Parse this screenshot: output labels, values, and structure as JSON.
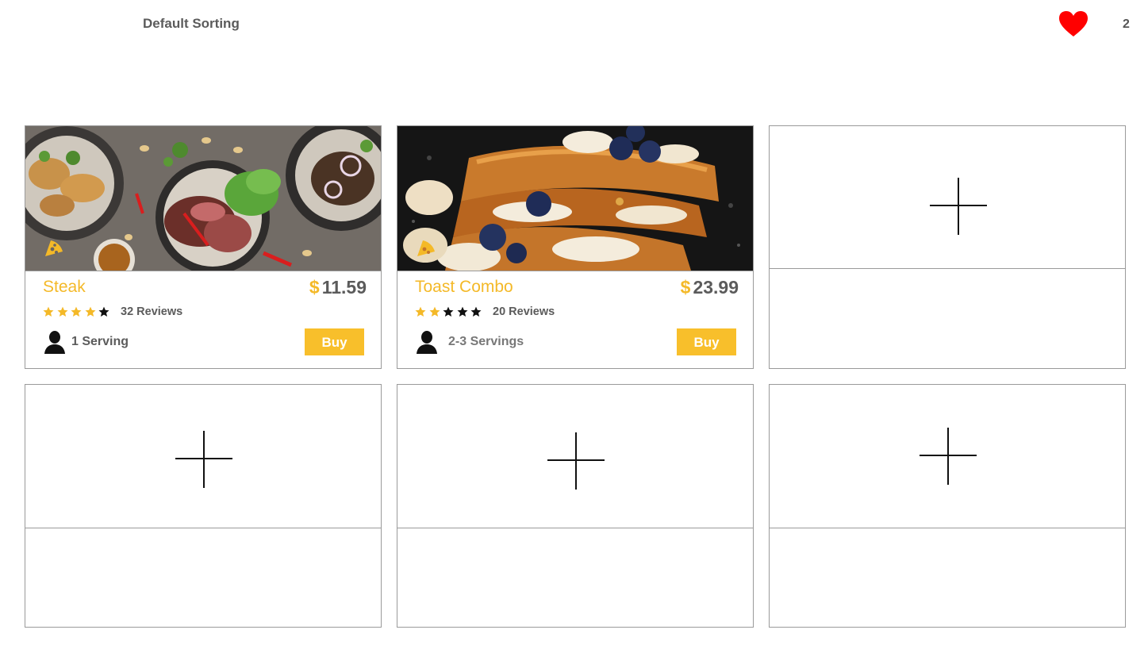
{
  "toolbar": {
    "sort_label": "Default Sorting",
    "favorites_count": "2",
    "favorites_icon": "heart-icon",
    "favorites_color": "#ff0000"
  },
  "accent_color": "#f4b928",
  "products": [
    {
      "name": "Steak",
      "currency": "$",
      "price": "11.59",
      "rating": 4,
      "rating_max": 5,
      "reviews": "32 Reviews",
      "servings": "1 Serving",
      "buy_label": "Buy"
    },
    {
      "name": "Toast Combo",
      "currency": "$",
      "price": "23.99",
      "rating": 2,
      "rating_max": 5,
      "reviews": "20 Reviews",
      "servings": "2-3 Servings",
      "buy_label": "Buy"
    }
  ],
  "empty_slots": 4
}
